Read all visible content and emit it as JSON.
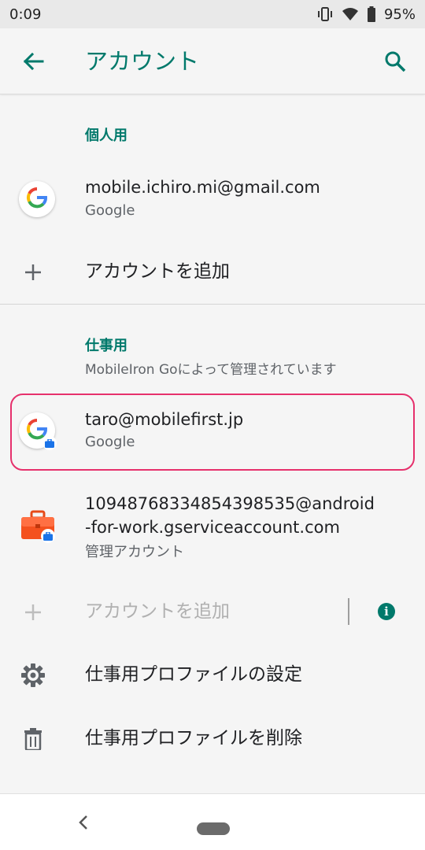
{
  "status": {
    "time": "0:09",
    "battery": "95%"
  },
  "header": {
    "title": "アカウント"
  },
  "personal": {
    "header": "個人用",
    "account": {
      "email": "mobile.ichiro.mi@gmail.com",
      "type": "Google"
    },
    "add_label": "アカウントを追加"
  },
  "work": {
    "header": "仕事用",
    "managed_by": "MobileIron Goによって管理されています",
    "account": {
      "email": "taro@mobilefirst.jp",
      "type": "Google"
    },
    "managed_account": {
      "line1": "10948768334854398535@android",
      "line2": "-for-work.gserviceaccount.com",
      "type": "管理アカウント"
    },
    "add_label": "アカウントを追加",
    "settings_label": "仕事用プロファイルの設定",
    "delete_label": "仕事用プロファイルを削除"
  },
  "colors": {
    "accent": "#00796b",
    "highlight": "#e6306c"
  }
}
